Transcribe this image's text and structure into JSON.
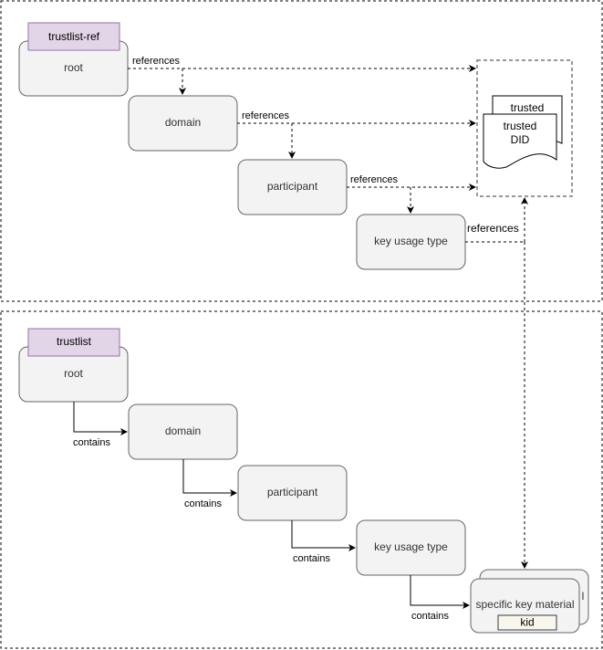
{
  "top_section": {
    "tag": "trustlist-ref",
    "nodes": [
      "root",
      "domain",
      "participant",
      "key usage type"
    ],
    "edge_label": "references",
    "target": {
      "back_doc": "trusted",
      "front_doc_line1": "trusted",
      "front_doc_line2": "DID"
    }
  },
  "bottom_section": {
    "tag": "trustlist",
    "nodes": [
      "root",
      "domain",
      "participant",
      "key usage type"
    ],
    "edge_label": "contains",
    "target": {
      "back_label": "l",
      "label": "specific key material",
      "kid": "kid"
    }
  }
}
